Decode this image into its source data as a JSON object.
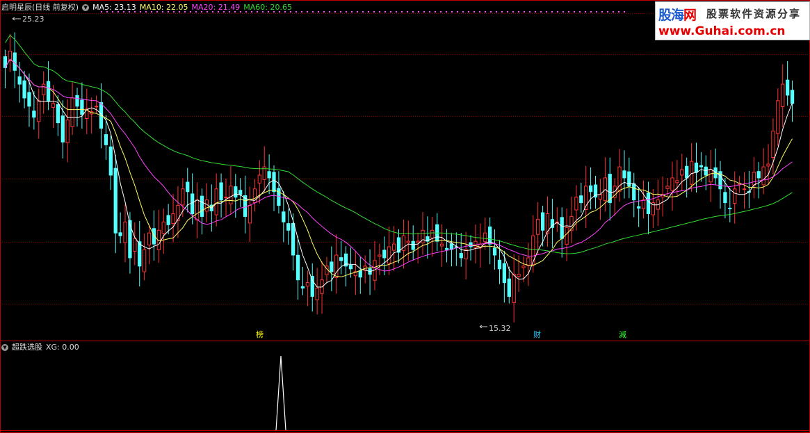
{
  "header": {
    "title": "启明星辰(日线 前复权)",
    "ma": [
      {
        "label": "MA5: 23.13",
        "color": "#ffffff"
      },
      {
        "label": "MA10: 22.05",
        "color": "#ffff66"
      },
      {
        "label": "MA20: 21.49",
        "color": "#ff44ff"
      },
      {
        "label": "MA60: 20.65",
        "color": "#33dd33"
      }
    ]
  },
  "indicator": {
    "title": "超跌选股",
    "value": "XG: 0.00"
  },
  "annotations": {
    "high": "25.23",
    "low": "15.32"
  },
  "markers": [
    {
      "text": "榜",
      "color": "#ffff00"
    },
    {
      "text": "财",
      "color": "#33ccff"
    },
    {
      "text": "減",
      "color": "#33ff33"
    }
  ],
  "watermark": {
    "brand_a": "股海",
    "brand_b": "网",
    "slogan": "股票软件资源分享",
    "url": "www.Guhai.com.cn"
  },
  "colors": {
    "up": "#ff3333",
    "down": "#54ffff",
    "ma5": "#ffffff",
    "ma10": "#ffff66",
    "ma20": "#ff44ff",
    "ma60": "#33dd33",
    "grid": "#8b0000",
    "border": "#c00000"
  },
  "chart_data": {
    "type": "candlestick",
    "price_range": [
      14.6,
      26.2
    ],
    "closes": [
      24.2,
      24.8,
      24.1,
      23.6,
      23.1,
      22.8,
      22.4,
      23.0,
      23.6,
      23.0,
      22.9,
      22.2,
      21.5,
      22.3,
      23.1,
      22.8,
      22.5,
      22.7,
      22.6,
      22.8,
      22.0,
      21.4,
      20.3,
      18.2,
      18.1,
      18.6,
      17.3,
      18.0,
      17.0,
      17.6,
      18.2,
      17.8,
      18.3,
      18.6,
      18.5,
      18.9,
      19.2,
      19.8,
      19.7,
      18.9,
      19.4,
      18.8,
      19.4,
      19.0,
      19.8,
      19.4,
      19.5,
      19.9,
      19.5,
      19.6,
      18.8,
      19.2,
      19.8,
      20.3,
      20.6,
      20.2,
      19.7,
      19.2,
      18.6,
      18.3,
      17.4,
      16.5,
      16.2,
      16.4,
      15.9,
      16.2,
      16.5,
      17.0,
      16.8,
      17.4,
      17.2,
      17.0,
      16.9,
      16.8,
      16.6,
      17.0,
      16.7,
      17.2,
      17.4,
      17.3,
      17.7,
      17.8,
      17.5,
      18.1,
      17.9,
      17.6,
      17.9,
      18.3,
      17.9,
      18.3,
      17.9,
      17.8,
      17.6,
      17.6,
      17.7,
      17.3,
      17.6,
      17.7,
      17.9,
      17.8,
      18.2,
      17.8,
      17.4,
      16.9,
      16.4,
      15.9,
      16.7,
      16.7,
      17.0,
      17.3,
      18.1,
      18.7,
      18.3,
      18.9,
      18.4,
      18.6,
      18.0,
      18.4,
      18.8,
      19.5,
      19.3,
      19.9,
      19.7,
      19.5,
      19.6,
      20.2,
      19.3,
      19.9,
      20.6,
      20.2,
      19.9,
      19.4,
      19.1,
      19.4,
      18.9,
      19.3,
      19.4,
      19.6,
      19.9,
      20.2,
      20.1,
      20.5,
      20.2,
      20.8,
      20.4,
      20.6,
      20.3,
      20.5,
      20.2,
      19.8,
      19.3,
      19.1,
      19.8,
      20.0,
      19.8,
      19.7,
      20.4,
      20.2,
      20.6,
      20.7,
      21.9,
      23.0,
      23.6,
      23.2,
      22.9
    ]
  }
}
